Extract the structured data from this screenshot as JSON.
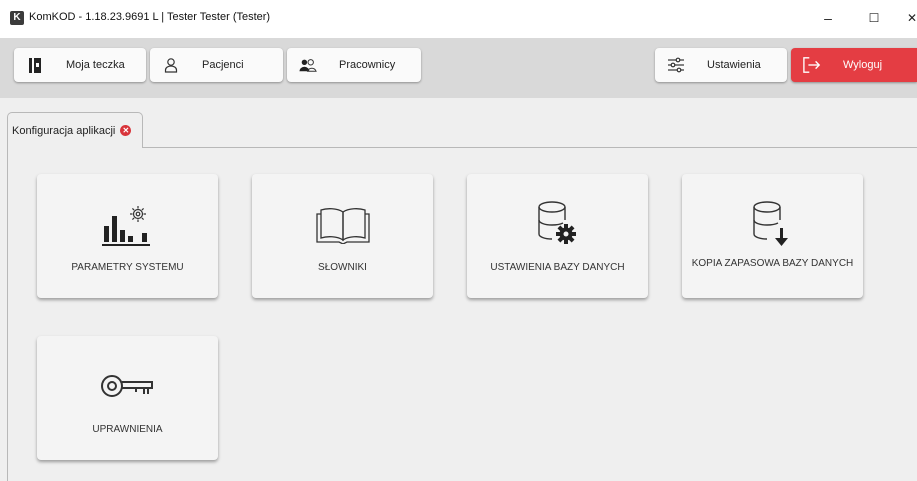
{
  "window": {
    "logo_letter": "K",
    "title": "KomKOD - 1.18.23.9691 L | Tester Tester (Tester)",
    "controls": {
      "minimize": "–",
      "maximize": "☐",
      "close": "✕"
    }
  },
  "toolbar": {
    "buttons": [
      {
        "label": "Moja teczka",
        "icon": "folder-icon"
      },
      {
        "label": "Pacjenci",
        "icon": "person-icon"
      },
      {
        "label": "Pracownicy",
        "icon": "people-icon"
      },
      {
        "label": "Ustawienia",
        "icon": "sliders-icon"
      },
      {
        "label": "Wyloguj",
        "icon": "logout-icon"
      }
    ],
    "logout_color": "#e43d43"
  },
  "tabs": [
    {
      "label": "Konfiguracja aplikacji",
      "close_icon": "close-circle-icon"
    }
  ],
  "tiles": [
    {
      "label": "PARAMETRY SYSTEMU",
      "icon": "chart-gear-icon"
    },
    {
      "label": "SŁOWNIKI",
      "icon": "open-book-icon"
    },
    {
      "label": "USTAWIENIA BAZY DANYCH",
      "icon": "database-gear-icon"
    },
    {
      "label": "KOPIA ZAPASOWA BAZY DANYCH",
      "icon": "database-download-icon"
    },
    {
      "label": "UPRAWNIENIA",
      "icon": "key-icon"
    }
  ]
}
